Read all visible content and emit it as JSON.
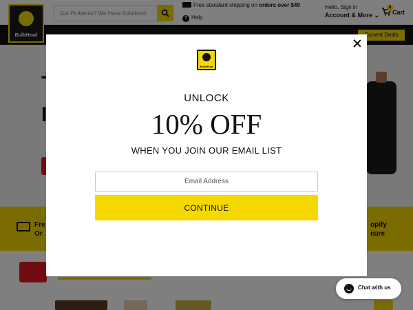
{
  "header": {
    "logo_text": "BulbHead",
    "search_placeholder": "Got Problems? We Have Solutions!",
    "shipping_text": "Free standard shipping on ",
    "shipping_bold": "orders over $49",
    "help_label": "Help",
    "signin_greeting": "Hello, Sign in",
    "account_label": "Account & More ⌄",
    "cart_label": "Cart",
    "cart_count": "0"
  },
  "nav": {
    "deals_label": "Current Deals"
  },
  "features": {
    "left_line1": "Fre",
    "left_line2": "Or",
    "right_line1": "opify",
    "right_line2": "cure"
  },
  "chat": {
    "label": "Chat with us"
  },
  "modal": {
    "logo_text": "BulbHead",
    "unlock": "UNLOCK",
    "discount": "10% OFF",
    "subtitle": "WHEN YOU JOIN OUR EMAIL LIST",
    "email_placeholder": "Email Address",
    "continue_label": "CONTINUE"
  },
  "colors": {
    "brand_yellow": "#f5d800",
    "dark": "#111111",
    "overlay": "rgba(0,0,0,0.5)"
  }
}
